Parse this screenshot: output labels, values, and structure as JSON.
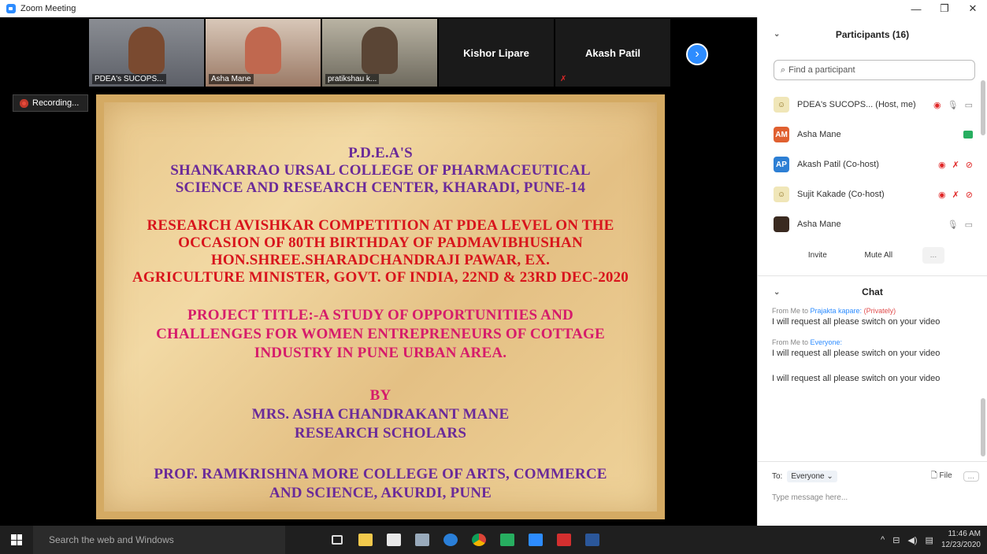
{
  "window": {
    "title": "Zoom Meeting",
    "minimize": "—",
    "restore": "❐",
    "close": "✕"
  },
  "thumbnails": [
    {
      "name": "PDEA's SUCOPS..."
    },
    {
      "name": "Asha Mane"
    },
    {
      "name": "pratikshau k..."
    },
    {
      "name": "Kishor Lipare"
    },
    {
      "name": "Akash Patil"
    }
  ],
  "recording": {
    "label": "Recording..."
  },
  "slide": {
    "lines": [
      "P.D.E.A'S",
      "SHANKARRAO URSAL COLLEGE OF PHARMACEUTICAL",
      "SCIENCE AND RESEARCH CENTER, KHARADI, PUNE-14",
      "RESEARCH AVISHKAR COMPETITION AT PDEA LEVEL ON THE",
      "OCCASION OF 80TH  BIRTHDAY OF PADMAVIBHUSHAN",
      "HON.SHREE.SHARADCHANDRAJI PAWAR, EX.",
      "AGRICULTURE  MINISTER, GOVT. OF INDIA, 22ND & 23RD DEC-2020",
      "PROJECT TITLE:-A STUDY OF OPPORTUNITIES AND",
      "CHALLENGES FOR WOMEN ENTREPRENEURS OF COTTAGE",
      "INDUSTRY IN PUNE URBAN AREA.",
      "BY",
      "MRS. ASHA CHANDRAKANT MANE",
      "RESEARCH SCHOLARS",
      "PROF. RAMKRISHNA MORE COLLEGE OF ARTS, COMMERCE",
      "AND SCIENCE, AKURDI, PUNE"
    ]
  },
  "participants": {
    "header": "Participants (16)",
    "search_placeholder": "Find a participant",
    "list": [
      {
        "name": "PDEA's SUCOPS...  (Host, me)",
        "initials": ""
      },
      {
        "name": "Asha Mane",
        "initials": "AM"
      },
      {
        "name": "Akash Patil (Co-host)",
        "initials": "AP"
      },
      {
        "name": "Sujit Kakade (Co-host)",
        "initials": ""
      },
      {
        "name": "Asha Mane",
        "initials": ""
      }
    ],
    "invite": "Invite",
    "mute_all": "Mute All",
    "more": "..."
  },
  "chat": {
    "header": "Chat",
    "messages": [
      {
        "from_prefix": "From Me to ",
        "to": "Prajakta kapare:",
        "privately": "(Privately)",
        "text": "I will request all please switch on your video"
      },
      {
        "from_prefix": "From Me to ",
        "to": "Everyone:",
        "privately": "",
        "text": "I will request all please switch on your video"
      },
      {
        "from_prefix": "",
        "to": "",
        "privately": "",
        "text": "I will request all please switch on your video"
      }
    ],
    "to_label": "To:",
    "to_value": "Everyone ⌄",
    "file": "File",
    "more": "...",
    "input_placeholder": "Type message here..."
  },
  "taskbar": {
    "search": "Search the web and Windows",
    "time": "11:46 AM",
    "date": "12/23/2020"
  }
}
